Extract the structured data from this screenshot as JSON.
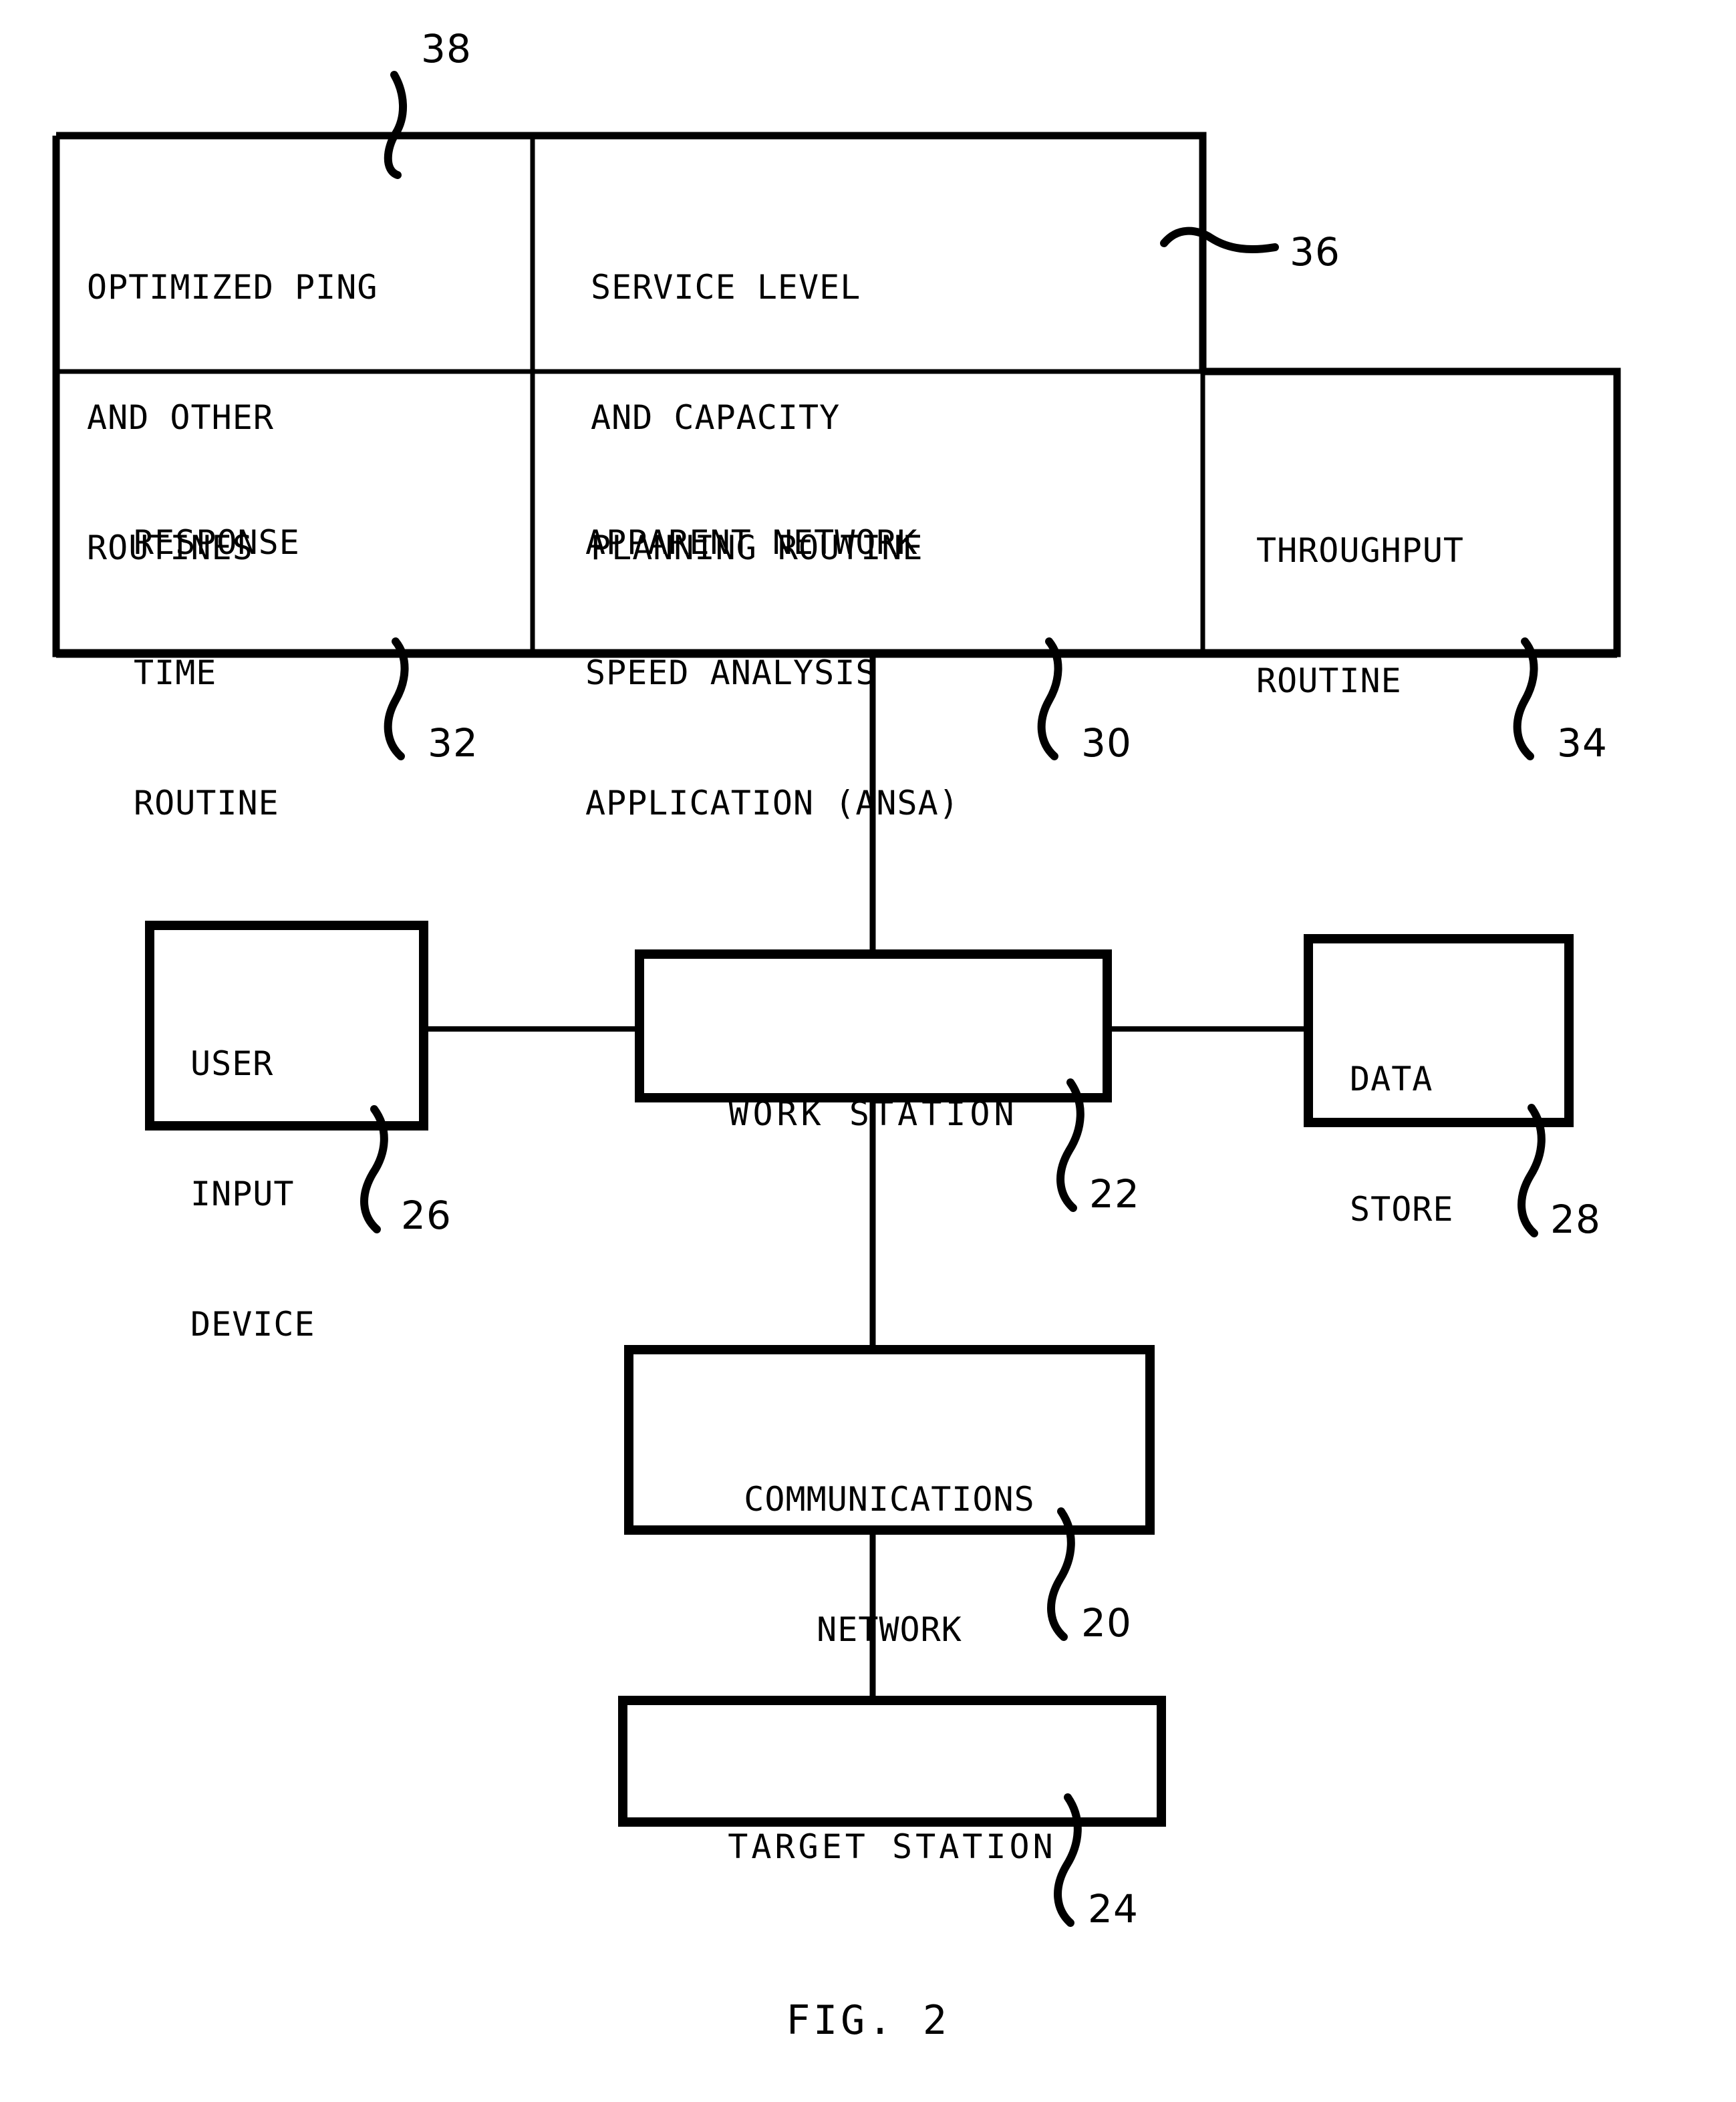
{
  "figure": {
    "caption": "FIG. 2",
    "type": "patent-block-diagram"
  },
  "application_table": {
    "reference_numeral_top_left": "38",
    "reference_numeral_top_right": "36",
    "cells": [
      {
        "id": "optimized-ping",
        "lines": [
          "OPTIMIZED PING",
          "AND OTHER",
          "ROUTINES"
        ],
        "reference_numeral": "38",
        "row": 1,
        "col": 1
      },
      {
        "id": "service-level",
        "lines": [
          "SERVICE LEVEL",
          "AND CAPACITY",
          "PLANNING ROUTINE"
        ],
        "reference_numeral": "36",
        "row": 1,
        "col": 2
      },
      {
        "id": "response-time",
        "lines": [
          "RESPONSE",
          "TIME",
          "ROUTINE"
        ],
        "reference_numeral": "32",
        "row": 2,
        "col": 1
      },
      {
        "id": "ansa",
        "lines": [
          "APPARENT NETWORK",
          "SPEED ANALYSIS",
          "APPLICATION (ANSA)"
        ],
        "reference_numeral": "30",
        "row": 2,
        "col": 2
      },
      {
        "id": "throughput",
        "lines": [
          "THROUGHPUT",
          "ROUTINE"
        ],
        "reference_numeral": "34",
        "row": 2,
        "col": 3
      }
    ]
  },
  "blocks": [
    {
      "id": "user-input-device",
      "lines": [
        "USER",
        "INPUT",
        "DEVICE"
      ],
      "reference_numeral": "26",
      "align": "left"
    },
    {
      "id": "work-station",
      "lines": [
        "WORK STATION"
      ],
      "reference_numeral": "22",
      "align": "center"
    },
    {
      "id": "data-store",
      "lines": [
        "DATA",
        "STORE"
      ],
      "reference_numeral": "28",
      "align": "left"
    },
    {
      "id": "communications-network",
      "lines": [
        "COMMUNICATIONS",
        "NETWORK"
      ],
      "reference_numeral": "20",
      "align": "center"
    },
    {
      "id": "target-station",
      "lines": [
        "TARGET STATION"
      ],
      "reference_numeral": "24",
      "align": "center"
    }
  ],
  "reference_numerals": {
    "n20": "20",
    "n22": "22",
    "n24": "24",
    "n26": "26",
    "n28": "28",
    "n30": "30",
    "n32": "32",
    "n34": "34",
    "n36": "36",
    "n38": "38"
  },
  "colors": {
    "ink": "#000000",
    "paper": "#ffffff"
  }
}
